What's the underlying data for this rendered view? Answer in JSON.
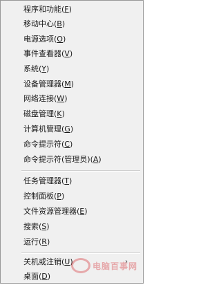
{
  "menu": {
    "group1": [
      {
        "label": "程序和功能",
        "accel": "F"
      },
      {
        "label": "移动中心",
        "accel": "B"
      },
      {
        "label": "电源选项",
        "accel": "O"
      },
      {
        "label": "事件查看器",
        "accel": "V"
      },
      {
        "label": "系统",
        "accel": "Y"
      },
      {
        "label": "设备管理器",
        "accel": "M"
      },
      {
        "label": "网络连接",
        "accel": "W"
      },
      {
        "label": "磁盘管理",
        "accel": "K"
      },
      {
        "label": "计算机管理",
        "accel": "G"
      },
      {
        "label": "命令提示符",
        "accel": "C"
      },
      {
        "label": "命令提示符(管理员)",
        "accel": "A"
      }
    ],
    "group2": [
      {
        "label": "任务管理器",
        "accel": "T"
      },
      {
        "label": "控制面板",
        "accel": "P"
      },
      {
        "label": "文件资源管理器",
        "accel": "E"
      },
      {
        "label": "搜索",
        "accel": "S"
      },
      {
        "label": "运行",
        "accel": "R"
      }
    ],
    "group3": [
      {
        "label": "关机或注销",
        "accel": "U",
        "submenu_glyph": "›"
      },
      {
        "label": "桌面",
        "accel": "D"
      }
    ]
  },
  "watermark": {
    "text": "电脑百事网"
  }
}
